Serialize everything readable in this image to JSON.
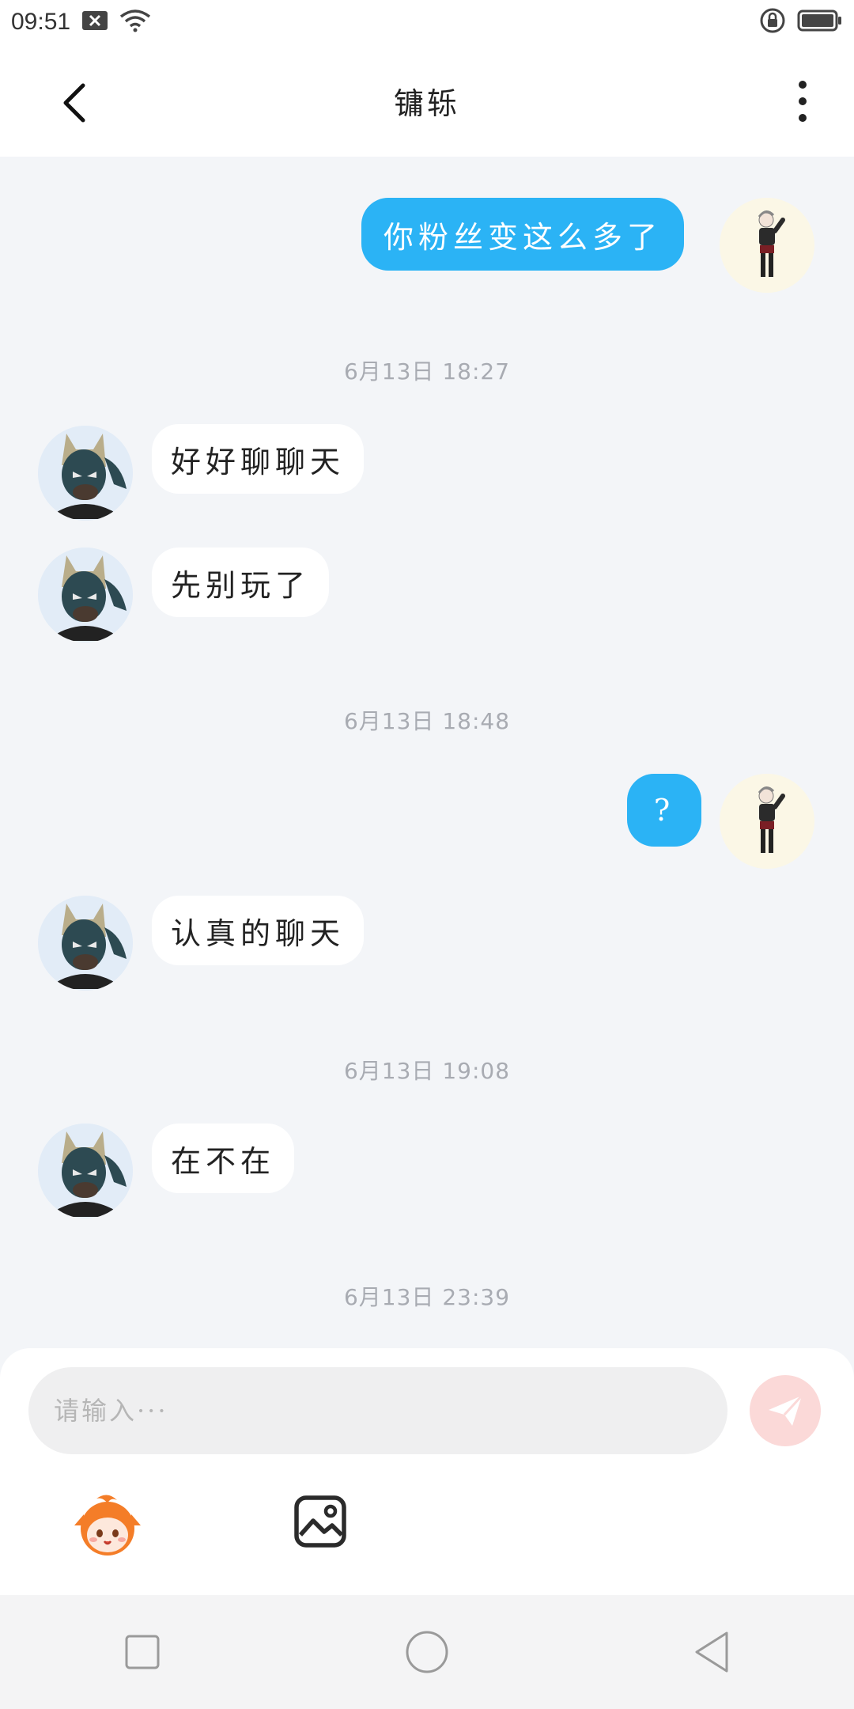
{
  "status_bar": {
    "time": "09:51",
    "icons": [
      "notification-x-icon",
      "wifi-icon",
      "rotation-lock-icon",
      "battery-icon"
    ]
  },
  "header": {
    "title": "镛轹",
    "back_icon": "chevron-left-icon",
    "more_icon": "more-vertical-icon"
  },
  "messages": [
    {
      "type": "message",
      "direction": "out",
      "text": "你粉丝变这么多了"
    },
    {
      "type": "timestamp",
      "text": "6月13日 18:27"
    },
    {
      "type": "message",
      "direction": "in",
      "text": "好好聊聊天"
    },
    {
      "type": "message",
      "direction": "in",
      "text": "先别玩了"
    },
    {
      "type": "timestamp",
      "text": "6月13日 18:48"
    },
    {
      "type": "message",
      "direction": "out",
      "text": "?"
    },
    {
      "type": "message",
      "direction": "in",
      "text": "认真的聊天"
    },
    {
      "type": "timestamp",
      "text": "6月13日 19:08"
    },
    {
      "type": "message",
      "direction": "in",
      "text": "在不在"
    },
    {
      "type": "timestamp",
      "text": "6月13日 23:39"
    }
  ],
  "input": {
    "placeholder": "请输入···",
    "value": "",
    "send_icon": "paper-plane-icon",
    "emoji_icon": "mascot-emoji-icon",
    "image_icon": "image-icon"
  },
  "nav_bar": {
    "icons": [
      "recents-square-icon",
      "home-circle-icon",
      "back-triangle-icon"
    ]
  },
  "colors": {
    "outgoing_bubble": "#2bb3f5",
    "incoming_bubble": "#ffffff",
    "chat_background": "#f3f5f8",
    "send_button": "#fbd9d8",
    "timestamp_text": "#a8abb2"
  }
}
